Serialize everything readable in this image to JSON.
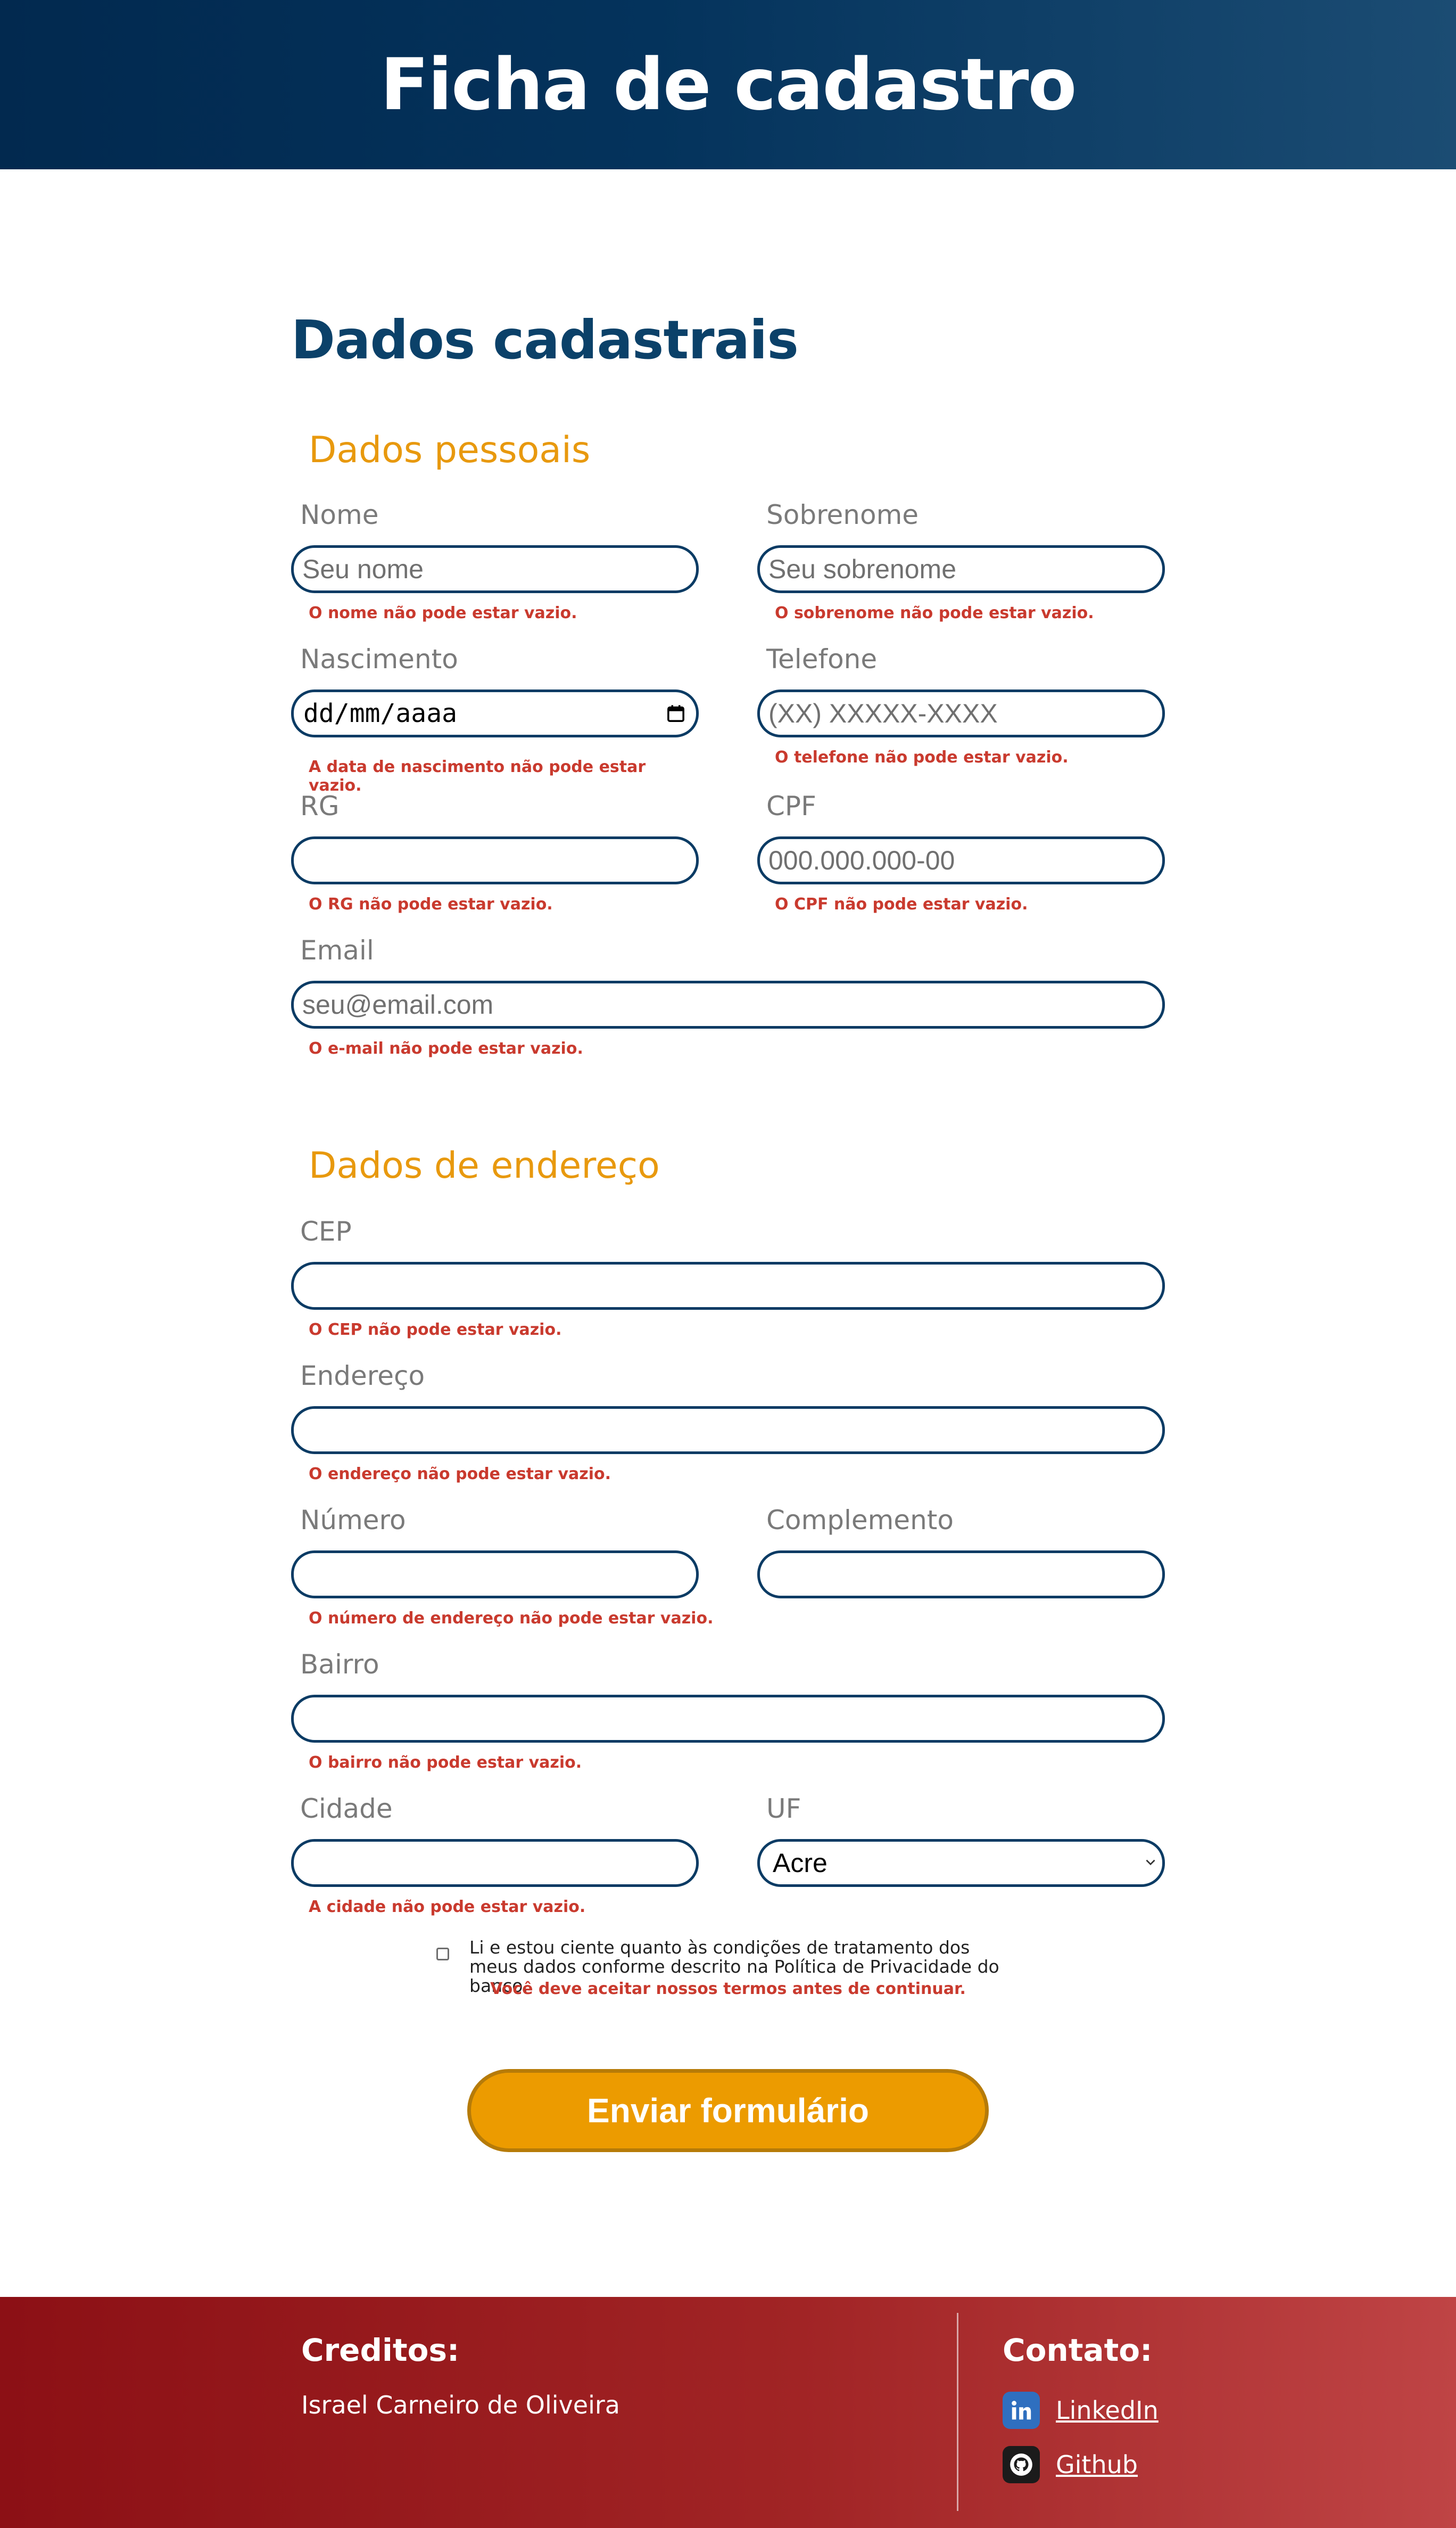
{
  "header": {
    "title": "Ficha de cadastro"
  },
  "form": {
    "title": "Dados cadastrais",
    "personal_section": "Dados pessoais",
    "address_section": "Dados de endereço",
    "fields": {
      "nome": {
        "label": "Nome",
        "placeholder": "Seu nome",
        "error": "O nome não pode estar vazio."
      },
      "sobrenome": {
        "label": "Sobrenome",
        "placeholder": "Seu sobrenome",
        "error": "O sobrenome não pode estar vazio."
      },
      "nascimento": {
        "label": "Nascimento",
        "value": "dd/mm/aaaa",
        "error": "A data de nascimento não pode estar vazio."
      },
      "telefone": {
        "label": "Telefone",
        "placeholder": "(XX) XXXXX-XXXX",
        "error": "O telefone não pode estar vazio."
      },
      "rg": {
        "label": "RG",
        "placeholder": "",
        "error": "O RG não pode estar vazio."
      },
      "cpf": {
        "label": "CPF",
        "placeholder": "000.000.000-00",
        "error": "O CPF não pode estar vazio."
      },
      "email": {
        "label": "Email",
        "placeholder": "seu@email.com",
        "error": "O e-mail não pode estar vazio."
      },
      "cep": {
        "label": "CEP",
        "placeholder": "",
        "error": "O CEP não pode estar vazio."
      },
      "endereco": {
        "label": "Endereço",
        "placeholder": "",
        "error": "O endereço não pode estar vazio."
      },
      "numero": {
        "label": "Número",
        "placeholder": "",
        "error": "O número de endereço não pode estar vazio."
      },
      "complemento": {
        "label": "Complemento",
        "placeholder": ""
      },
      "bairro": {
        "label": "Bairro",
        "placeholder": "",
        "error": "O bairro não pode estar vazio."
      },
      "cidade": {
        "label": "Cidade",
        "placeholder": "",
        "error": "A cidade não pode estar vazio."
      },
      "uf": {
        "label": "UF",
        "selected": "Acre"
      }
    },
    "terms": {
      "text": "Li e estou ciente quanto às condições de tratamento dos meus dados conforme descrito na Política de Privacidade do banco.",
      "error": "Você deve aceitar nossos termos antes de continuar.",
      "checked": false
    },
    "submit_label": "Enviar formulário"
  },
  "footer": {
    "credits_title": "Creditos:",
    "credits_name": "Israel Carneiro de Oliveira",
    "contact_title": "Contato:",
    "links": [
      {
        "label": "LinkedIn",
        "icon": "linkedin-icon"
      },
      {
        "label": "Github",
        "icon": "github-icon"
      }
    ]
  },
  "colors": {
    "header_bg": "#02294f",
    "title_blue": "#0b4169",
    "section_orange": "#e8990e",
    "error_red": "#c93a2e",
    "button_orange": "#ec9b00",
    "footer_red": "#8c1015"
  }
}
